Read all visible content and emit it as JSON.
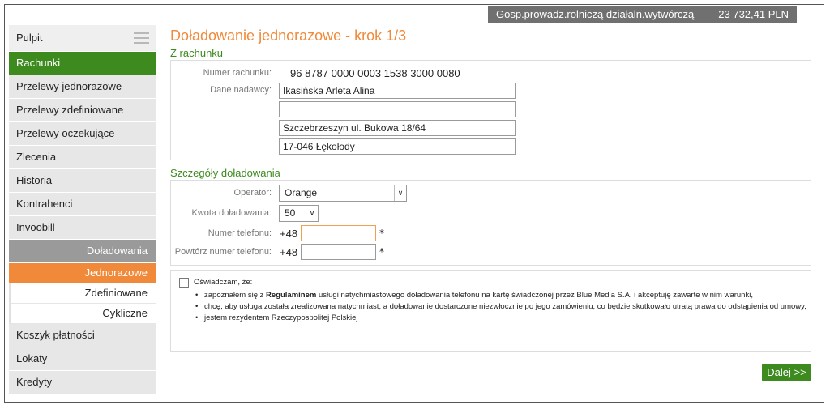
{
  "account": {
    "name": "Gosp.prowadz.rolniczą działaln.wytwórczą",
    "balance": "23 732,41 PLN"
  },
  "sidebar": {
    "items": [
      {
        "label": "Pulpit"
      },
      {
        "label": "Rachunki"
      },
      {
        "label": "Przelewy jednorazowe"
      },
      {
        "label": "Przelewy zdefiniowane"
      },
      {
        "label": "Przelewy oczekujące"
      },
      {
        "label": "Zlecenia"
      },
      {
        "label": "Historia"
      },
      {
        "label": "Kontrahenci"
      },
      {
        "label": "Invoobill"
      },
      {
        "label": "Doładowania"
      }
    ],
    "sub_items": [
      {
        "label": "Jednorazowe"
      },
      {
        "label": "Zdefiniowane"
      },
      {
        "label": "Cykliczne"
      }
    ],
    "bottom_items": [
      {
        "label": "Koszyk płatności"
      },
      {
        "label": "Lokaty"
      },
      {
        "label": "Kredyty"
      }
    ]
  },
  "page": {
    "title": "Doładowanie jednorazowe - krok 1/3"
  },
  "from_account": {
    "heading": "Z rachunku",
    "account_number_label": "Numer rachunku:",
    "account_number": "96 8787 0000 0003 1538 3000 0080",
    "sender_label": "Dane nadawcy:",
    "sender_line1": "Ikasińska Arleta Alina",
    "sender_line2": "",
    "sender_line3": "Szczebrzeszyn ul. Bukowa 18/64",
    "sender_line4": "17-046 Łękołody"
  },
  "topup": {
    "heading": "Szczegóły doładowania",
    "operator_label": "Operator:",
    "operator_value": "Orange",
    "amount_label": "Kwota doładowania:",
    "amount_value": "50",
    "phone_label": "Numer telefonu:",
    "phone_prefix": "+48",
    "phone_value": "",
    "phone_repeat_label": "Powtórz numer telefonu:",
    "phone_repeat_prefix": "+48",
    "phone_repeat_value": "",
    "required_mark": "*"
  },
  "declaration": {
    "intro": "Oświadczam, że:",
    "line1_pre": "zapoznałem się z ",
    "line1_bold": "Regulaminem",
    "line1_post": " usługi natychmiastowego doładowania telefonu na kartę świadczonej przez Blue Media S.A. i akceptuję zawarte w nim warunki,",
    "line2": "chcę, aby usługa została zrealizowana natychmiast, a doładowanie dostarczone niezwłocznie po jego zamówieniu, co będzie skutkowało utratą prawa do odstąpienia od umowy,",
    "line3": "jestem rezydentem Rzeczypospolitej Polskiej"
  },
  "buttons": {
    "next": "Dalej >>"
  }
}
